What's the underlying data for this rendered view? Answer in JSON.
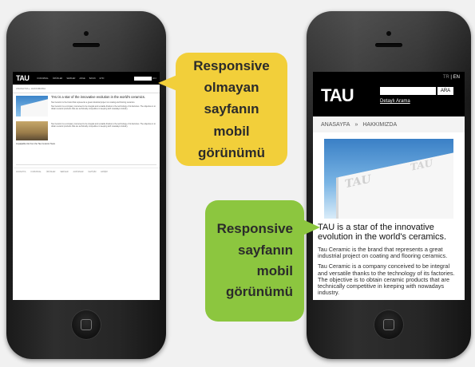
{
  "left_phone": {
    "header": {
      "logo": "TAU",
      "nav": [
        "KURUMSAL",
        "ÜRÜNLER",
        "SERİLER",
        "ARGE",
        "BASIN",
        "ETKİ"
      ],
      "search_button": "ARA"
    },
    "breadcrumb": "ANASAYFA » HAKKIMIZDA",
    "title": "TAU is a star of the innovative evolution in the world's ceramics.",
    "para1": "Tau Ceramic is the brand that represents a great industrial project on coating and flooring ceramics.",
    "para2": "Tau Ceramic is a company conceived to be integral and versatile thanks to the technology of its factories. The objective is to obtain ceramic products that are technically competitive in keeping with nowadays industry.",
    "caption": "Impalpable tile from the Tau Ceramic Team",
    "footer_nav": [
      "ANASAYFA",
      "KURUMSAL",
      "ÜRÜNLER",
      "SERİLER",
      "ALBÜMLER",
      "İLETİŞİM",
      "ERİŞİM"
    ]
  },
  "right_phone": {
    "header": {
      "logo": "TAU",
      "lang_tr": "TR",
      "lang_en": "EN",
      "search_button": "ARA",
      "detailed_search": "Detaylı Arama"
    },
    "breadcrumb": {
      "home": "ANASAYFA",
      "sep": "»",
      "current": "HAKKIMIZDA"
    },
    "title": "TAU is a star of the innovative evolution in the world's ceramics.",
    "para1": "Tau Ceramic is the brand that represents a great industrial project on coating and flooring ceramics.",
    "para2": "Tau Ceramic is a company conceived to be integral and versatile thanks to the technology of its factories. The objective is to obtain ceramic products that are technically competitive in keeping with nowadays industry.",
    "image_text": "TAU"
  },
  "callouts": {
    "yellow": [
      "Responsive",
      "olmayan",
      "sayfanın",
      "mobil",
      "görünümü"
    ],
    "green": [
      "Responsive",
      "sayfanın",
      "mobil",
      "görünümü"
    ]
  },
  "colors": {
    "yellow": "#f2cf3a",
    "green": "#8cc63f"
  }
}
